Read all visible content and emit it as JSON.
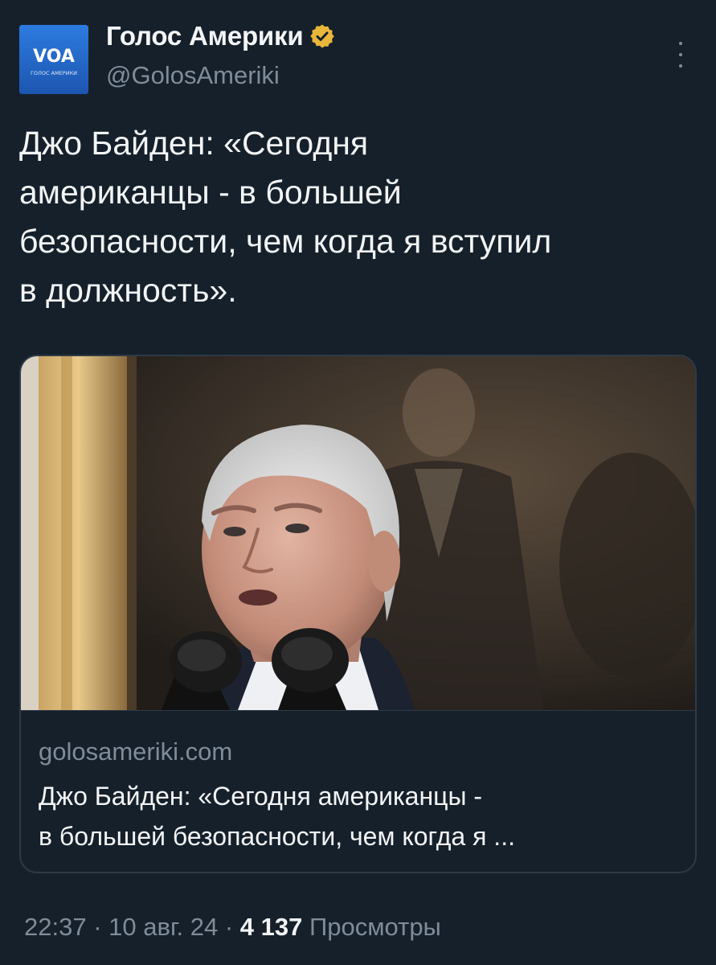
{
  "tweet": {
    "author_name": "Голос Америки",
    "handle": "@GolosAmeriki",
    "avatar": {
      "logo_text": "VOA",
      "caption": "ГОЛОС АМЕРИКИ",
      "color": "#2368c9"
    },
    "verified_badge_color": "#e8b73a",
    "text_lines": [
      "Джо Байден: «Сегодня",
      "американцы - в большей",
      "безопасности, чем когда я вступил",
      "в должность»."
    ],
    "card": {
      "domain": "golosameriki.com",
      "title_lines": [
        "Джо Байден: «Сегодня американцы -",
        "в большей безопасности, чем когда я ..."
      ]
    },
    "meta": {
      "time": "22:37",
      "date": "10 авг. 24",
      "separator": "·",
      "views_count": "4 137",
      "views_label": "Просмотры"
    }
  },
  "colors": {
    "background": "#16202b",
    "text_primary": "#f3f5f7",
    "text_secondary": "#7f8c99",
    "border": "#2d3a46"
  }
}
